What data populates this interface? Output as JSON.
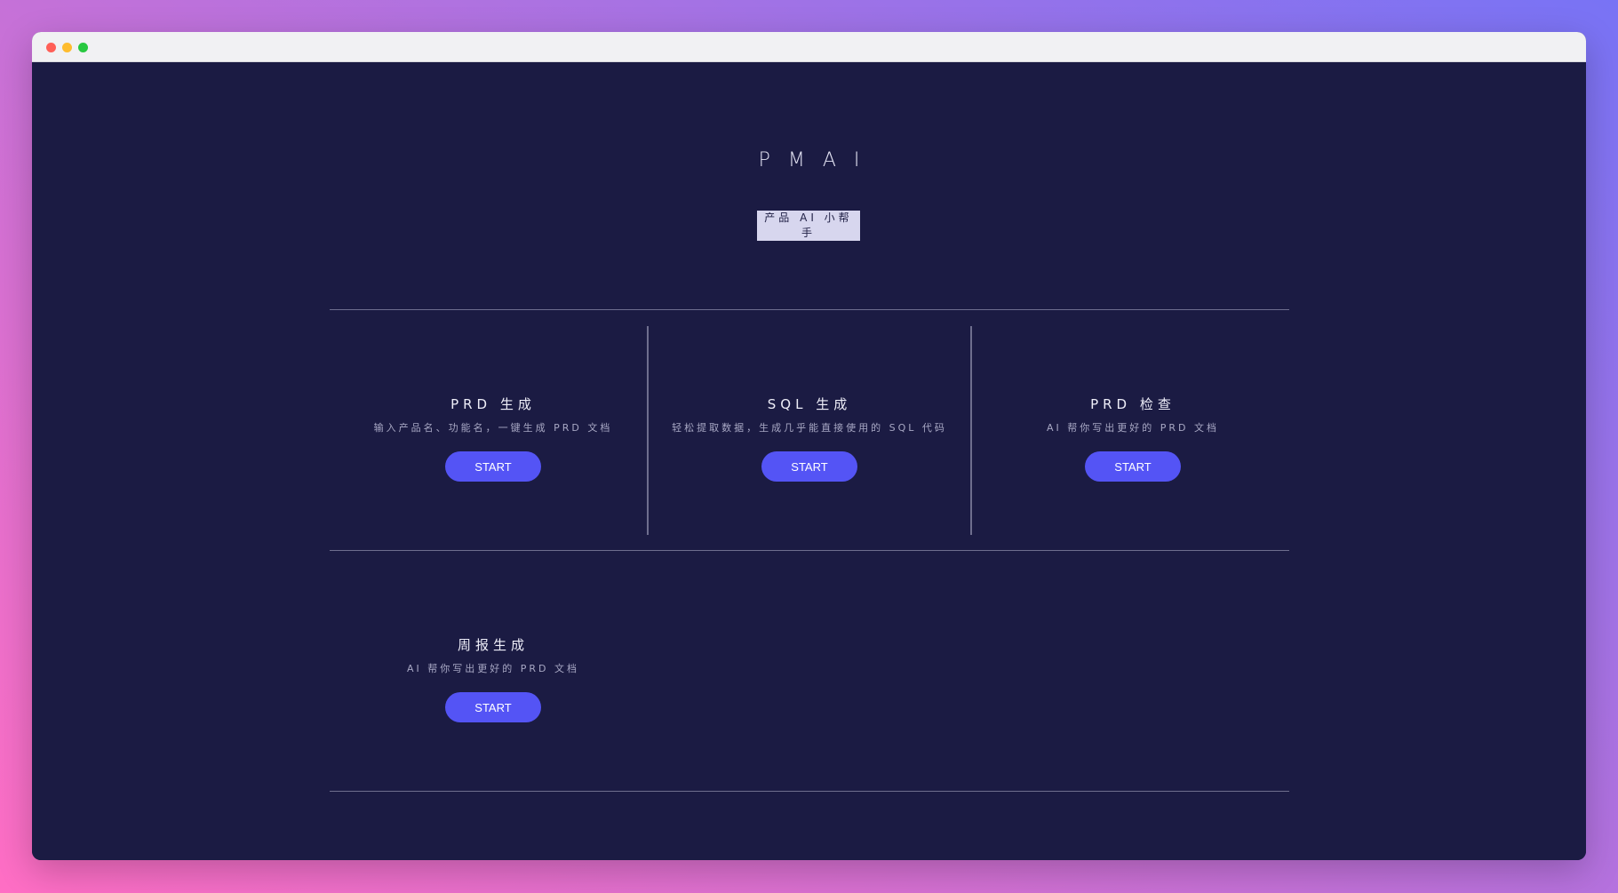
{
  "app": {
    "logo": "PMAI",
    "subtitle": "产品 AI 小帮手"
  },
  "colors": {
    "background": "#1b1b43",
    "accent": "#5454f5",
    "divider": "#6e6e8e"
  },
  "cards": [
    {
      "title": "PRD 生成",
      "description": "输入产品名、功能名，一键生成 PRD 文档",
      "button": "START"
    },
    {
      "title": "SQL 生成",
      "description": "轻松提取数据，生成几乎能直接使用的 SQL 代码",
      "button": "START"
    },
    {
      "title": "PRD 检查",
      "description": "AI 帮你写出更好的 PRD 文档",
      "button": "START"
    },
    {
      "title": "周报生成",
      "description": "AI 帮你写出更好的 PRD 文档",
      "button": "START"
    }
  ]
}
